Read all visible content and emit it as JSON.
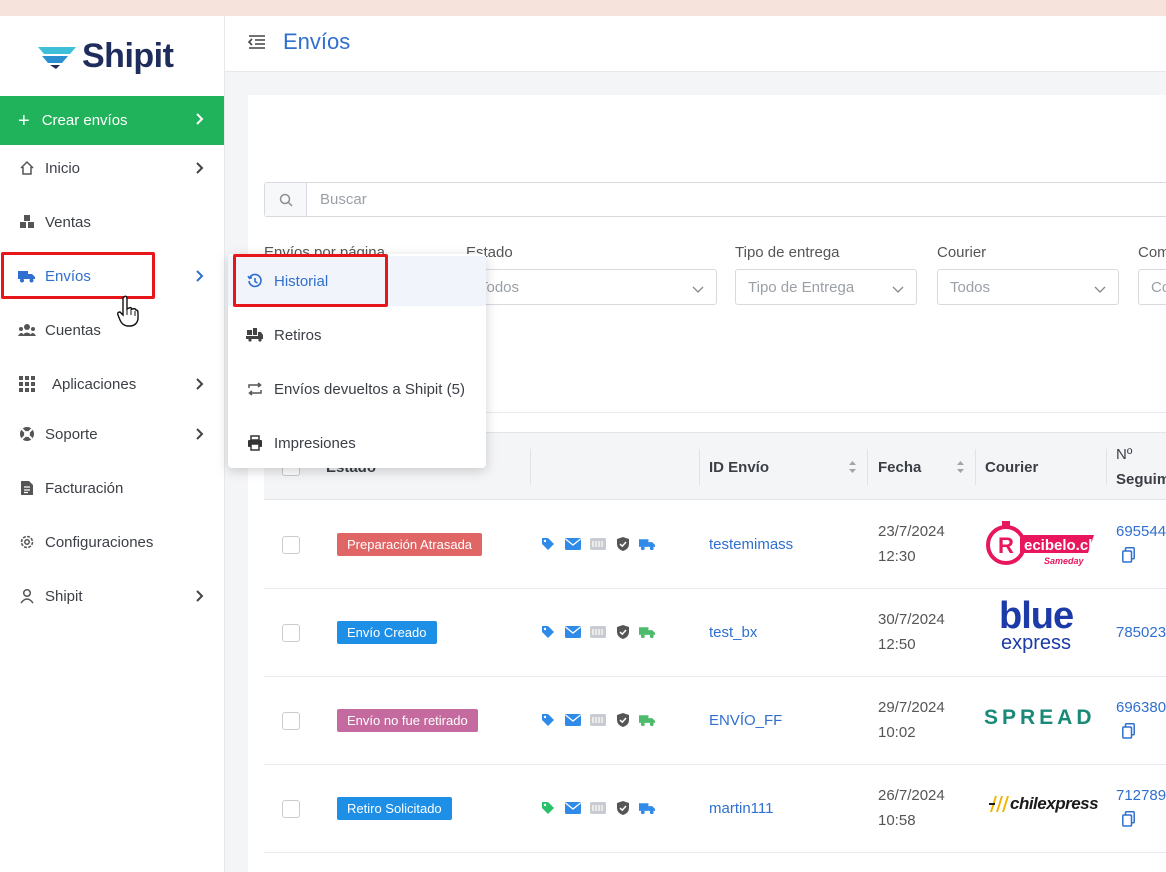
{
  "brand": {
    "name": "Shipit"
  },
  "sidebar": {
    "create_label": "Crear envíos",
    "items": [
      {
        "label": "Inicio",
        "icon": "home-icon",
        "has_chevron": true
      },
      {
        "label": "Ventas",
        "icon": "boxes-icon",
        "has_chevron": false
      },
      {
        "label": "Envíos",
        "icon": "truck-icon",
        "has_chevron": true,
        "active": true
      },
      {
        "label": "Cuentas",
        "icon": "users-icon",
        "has_chevron": false
      },
      {
        "label": "Aplicaciones",
        "icon": "grid-icon",
        "has_chevron": true
      },
      {
        "label": "Soporte",
        "icon": "lifebuoy-icon",
        "has_chevron": true
      },
      {
        "label": "Facturación",
        "icon": "invoice-icon",
        "has_chevron": false
      },
      {
        "label": "Configuraciones",
        "icon": "gear-icon",
        "has_chevron": false
      },
      {
        "label": "Shipit",
        "icon": "user-icon",
        "has_chevron": true
      }
    ]
  },
  "header": {
    "title": "Envíos"
  },
  "search": {
    "placeholder": "Buscar"
  },
  "filters": [
    {
      "label": "Envíos por página",
      "value": ""
    },
    {
      "label": "Estado",
      "value": "Todos"
    },
    {
      "label": "Tipo de entrega",
      "value": "Tipo de Entrega"
    },
    {
      "label": "Courier",
      "value": "Todos"
    },
    {
      "label": "Com",
      "value": "Co"
    }
  ],
  "submenu": {
    "items": [
      {
        "label": "Historial",
        "icon": "history-icon",
        "active": true
      },
      {
        "label": "Retiros",
        "icon": "pickup-truck-icon"
      },
      {
        "label": "Envíos devueltos a Shipit (5)",
        "icon": "return-arrows-icon"
      },
      {
        "label": "Impresiones",
        "icon": "printer-icon"
      }
    ]
  },
  "table": {
    "headers": {
      "estado": "Estado",
      "id": "ID Envío",
      "fecha": "Fecha",
      "courier": "Courier",
      "seguimiento_1": "Nº",
      "seguimiento_2": "Seguim"
    },
    "rows": [
      {
        "estado": "Preparación Atrasada",
        "estado_color": "#e06666",
        "id": "testemimass",
        "fecha": "23/7/2024",
        "hora": "12:30",
        "courier": "recibelo",
        "courier_text": "ecibelo.cl",
        "courier_sub": "Sameday",
        "tracking": "695544",
        "tag_color": "#2f8ae8",
        "truck_color": "#2f8ae8"
      },
      {
        "estado": "Envío Creado",
        "estado_color": "#1e8fe6",
        "id": "test_bx",
        "fecha": "30/7/2024",
        "hora": "12:50",
        "courier": "bluexpress",
        "courier_text": "blue",
        "courier_sub": "express",
        "tracking": "785023",
        "tag_color": "#2f8ae8",
        "truck_color": "#4cbb6b"
      },
      {
        "estado": "Envío no fue retirado",
        "estado_color": "#c56a9e",
        "id": "ENVÍO_FF",
        "fecha": "29/7/2024",
        "hora": "10:02",
        "courier": "spread",
        "courier_text": "SPREAD",
        "courier_sub": "",
        "tracking": "696380",
        "tag_color": "#2f8ae8",
        "truck_color": "#4cbb6b"
      },
      {
        "estado": "Retiro Solicitado",
        "estado_color": "#1e8fe6",
        "id": "martin111",
        "fecha": "26/7/2024",
        "hora": "10:58",
        "courier": "chilexpress",
        "courier_text": "chilexpress",
        "courier_sub": "",
        "tracking": "712789",
        "tag_color": "#27c26a",
        "truck_color": "#2f8ae8"
      }
    ]
  }
}
